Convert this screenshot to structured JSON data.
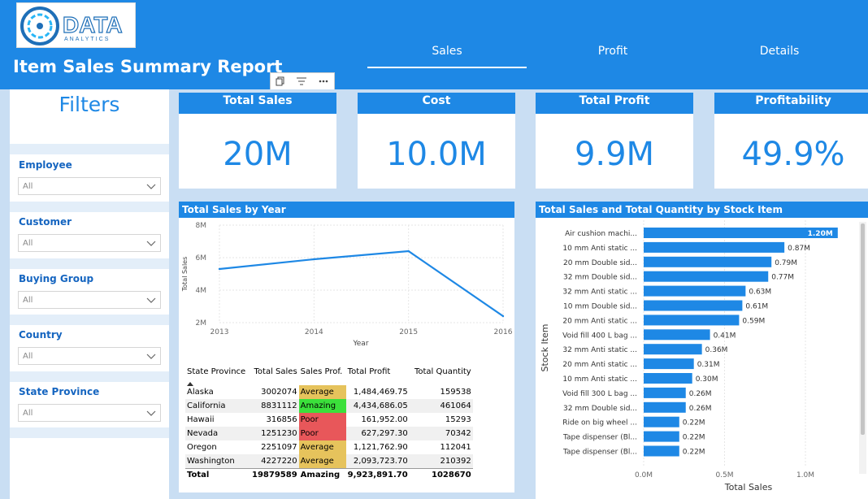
{
  "header": {
    "logo_text": "DATA",
    "logo_subtext": "ANALYTICS",
    "title": "Item Sales Summary Report",
    "tabs": [
      {
        "label": "Sales",
        "active": true
      },
      {
        "label": "Profit",
        "active": false
      },
      {
        "label": "Details",
        "active": false
      }
    ]
  },
  "visual_toolbar": {
    "icons": [
      "copy-icon",
      "filter-icon",
      "more-options-icon"
    ]
  },
  "filters": {
    "title": "Filters",
    "items": [
      {
        "label": "Employee",
        "value": "All"
      },
      {
        "label": "Customer",
        "value": "All"
      },
      {
        "label": "Buying Group",
        "value": "All"
      },
      {
        "label": "Country",
        "value": "All"
      },
      {
        "label": "State Province",
        "value": "All"
      }
    ]
  },
  "kpis": [
    {
      "label": "Total Sales",
      "value": "20M"
    },
    {
      "label": "Cost",
      "value": "10.0M"
    },
    {
      "label": "Total Profit",
      "value": "9.9M"
    },
    {
      "label": "Profitability",
      "value": "49.9%"
    }
  ],
  "line_chart": {
    "title": "Total Sales by Year",
    "ylabel": "Total Sales",
    "xlabel": "Year",
    "y_ticks": [
      "8M",
      "6M",
      "4M",
      "2M"
    ],
    "x_ticks": [
      "2013",
      "2014",
      "2015",
      "2016"
    ]
  },
  "table": {
    "headers": [
      "State Province",
      "Total Sales",
      "Sales Prof.",
      "Total Profit",
      "Total Quantity"
    ],
    "rows": [
      {
        "state": "Alaska",
        "sales": "3002074",
        "prof": "Average",
        "profit": "1,484,469.75",
        "qty": "159538"
      },
      {
        "state": "California",
        "sales": "8831112",
        "prof": "Amazing",
        "profit": "4,434,686.05",
        "qty": "461064"
      },
      {
        "state": "Hawaii",
        "sales": "316856",
        "prof": "Poor",
        "profit": "161,952.00",
        "qty": "15293"
      },
      {
        "state": "Nevada",
        "sales": "1251230",
        "prof": "Poor",
        "profit": "627,297.30",
        "qty": "70342"
      },
      {
        "state": "Oregon",
        "sales": "2251097",
        "prof": "Average",
        "profit": "1,121,762.90",
        "qty": "112041"
      },
      {
        "state": "Washington",
        "sales": "4227220",
        "prof": "Average",
        "profit": "2,093,723.70",
        "qty": "210392"
      }
    ],
    "total": {
      "state": "Total",
      "sales": "19879589",
      "prof": "Amazing",
      "profit": "9,923,891.70",
      "qty": "1028670"
    }
  },
  "bar_chart": {
    "title": "Total Sales and Total Quantity by Stock Item",
    "ylabel": "Stock Item",
    "xlabel": "Total Sales",
    "x_ticks": [
      "0.0M",
      "0.5M",
      "1.0M"
    ]
  },
  "chart_data": [
    {
      "type": "line",
      "title": "Total Sales by Year",
      "xlabel": "Year",
      "ylabel": "Total Sales",
      "x": [
        "2013",
        "2014",
        "2015",
        "2016"
      ],
      "values": [
        5.3,
        5.9,
        6.4,
        2.4
      ],
      "unit": "M",
      "ylim": [
        2,
        8
      ],
      "color": "#1e88e5"
    },
    {
      "type": "bar",
      "title": "Total Sales and Total Quantity by Stock Item",
      "orientation": "horizontal",
      "xlabel": "Total Sales",
      "ylabel": "Stock Item",
      "xlim": [
        0,
        1.2
      ],
      "unit": "M",
      "categories": [
        "Air cushion machi...",
        "10 mm Anti static ...",
        "20 mm Double sid...",
        "32 mm Double sid...",
        "32 mm Anti static ...",
        "10 mm Double sid...",
        "20 mm Anti static ...",
        "Void fill 400 L bag ...",
        "32 mm Anti static ...",
        "20 mm Anti static ...",
        "10 mm Anti static ...",
        "Void fill 300 L bag ...",
        "32 mm Double sid...",
        "Ride on big wheel ...",
        "Tape dispenser (Bl...",
        "Tape dispenser (Bl..."
      ],
      "values": [
        1.2,
        0.87,
        0.79,
        0.77,
        0.63,
        0.61,
        0.59,
        0.41,
        0.36,
        0.31,
        0.3,
        0.26,
        0.26,
        0.22,
        0.22,
        0.22
      ],
      "labels": [
        "1.20M",
        "0.87M",
        "0.79M",
        "0.77M",
        "0.63M",
        "0.61M",
        "0.59M",
        "0.41M",
        "0.36M",
        "0.31M",
        "0.30M",
        "0.26M",
        "0.26M",
        "0.22M",
        "0.22M",
        "0.22M"
      ],
      "color": "#1e88e5"
    }
  ]
}
